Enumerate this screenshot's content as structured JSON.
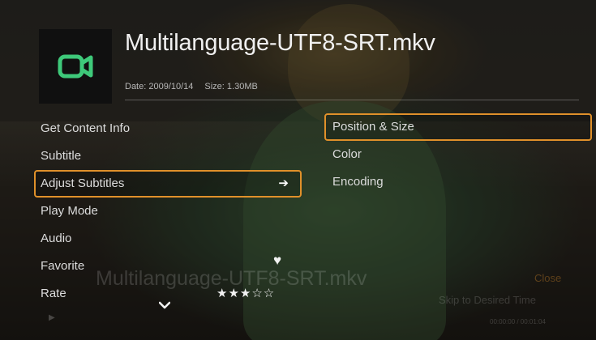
{
  "file": {
    "title": "Multilanguage-UTF8-SRT.mkv",
    "date": "Date: 2009/10/14",
    "size": "Size: 1.30MB",
    "icon": "video-camera-icon",
    "icon_color": "#3ec97a"
  },
  "menu": {
    "items": [
      {
        "label": "Get Content Info"
      },
      {
        "label": "Subtitle"
      },
      {
        "label": "Adjust Subtitles",
        "selected": true,
        "icon": "arrow-right-icon",
        "arrow": "➔"
      },
      {
        "label": "Play Mode"
      },
      {
        "label": "Audio"
      },
      {
        "label": "Favorite",
        "icon": "heart-icon",
        "heart": "♥"
      },
      {
        "label": "Rate",
        "stars": "★★★☆☆",
        "rating": 3,
        "max_rating": 5
      }
    ],
    "more_icon": "chevron-down-icon"
  },
  "submenu": {
    "items": [
      {
        "label": "Position & Size",
        "selected": true
      },
      {
        "label": "Color"
      },
      {
        "label": "Encoding"
      }
    ]
  },
  "underlay": {
    "title": "Multilanguage-UTF8-SRT.mkv",
    "close": "Close",
    "skip": "Skip to Desired Time",
    "time": "00:00:00 / 00:01:04",
    "play_icon": "play-icon",
    "play_glyph": "▶"
  },
  "colors": {
    "accent": "#e0902a",
    "icon": "#3ec97a"
  }
}
